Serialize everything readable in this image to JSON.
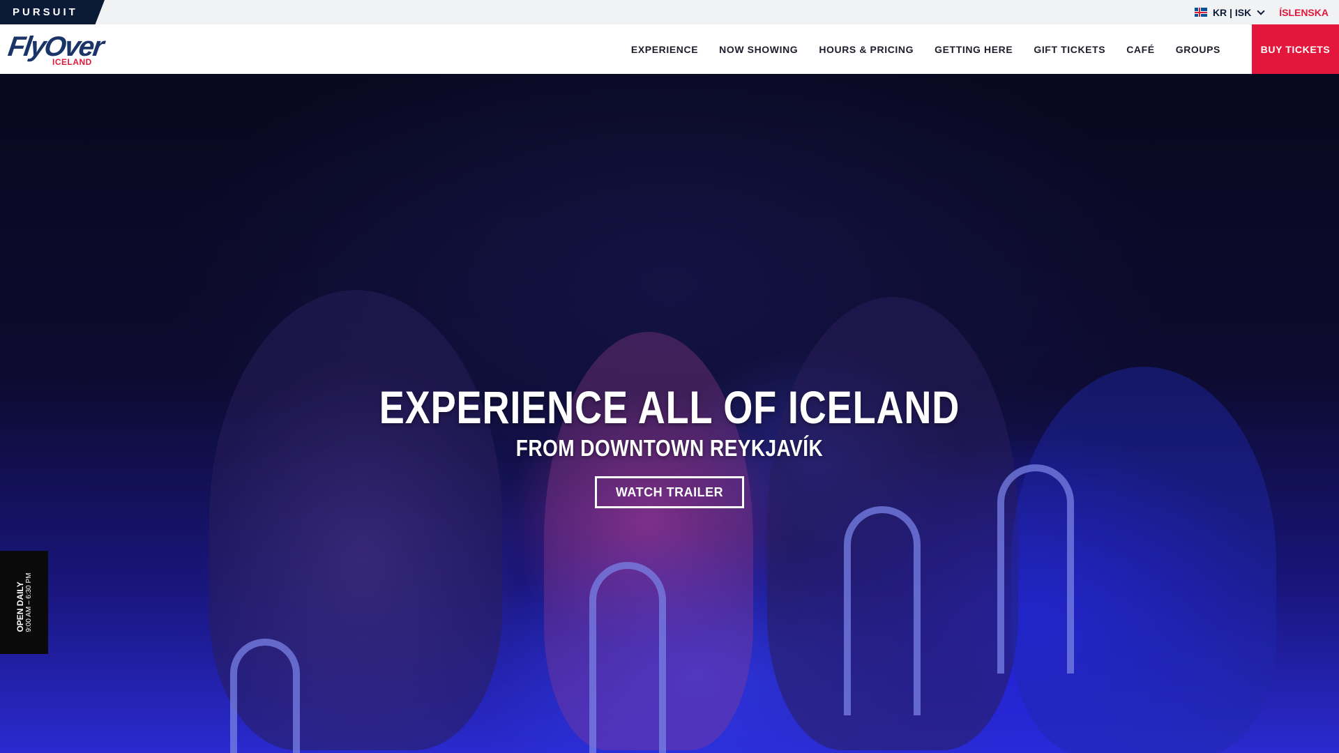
{
  "topbar": {
    "brand": "PURSUIT",
    "currency_label": "KR | ISK",
    "language_link": "ÍSLENSKA"
  },
  "logo": {
    "wordmark": "FlyOver",
    "subtitle": "ICELAND"
  },
  "nav": {
    "items": [
      {
        "label": "EXPERIENCE"
      },
      {
        "label": "NOW SHOWING"
      },
      {
        "label": "HOURS & PRICING"
      },
      {
        "label": "GETTING HERE"
      },
      {
        "label": "GIFT TICKETS"
      },
      {
        "label": "CAFÉ"
      },
      {
        "label": "GROUPS"
      }
    ],
    "buy_label": "BUY TICKETS"
  },
  "hero": {
    "title": "EXPERIENCE ALL OF ICELAND",
    "subtitle": "FROM DOWNTOWN REYKJAVÍK",
    "cta_label": "WATCH TRAILER"
  },
  "hours_badge": {
    "title": "OPEN DAILY",
    "hours": "9:00 AM – 6:30 PM"
  },
  "colors": {
    "accent_red": "#e3163b",
    "navy": "#0b1a36",
    "hero_blue": "#2a2ad0"
  }
}
